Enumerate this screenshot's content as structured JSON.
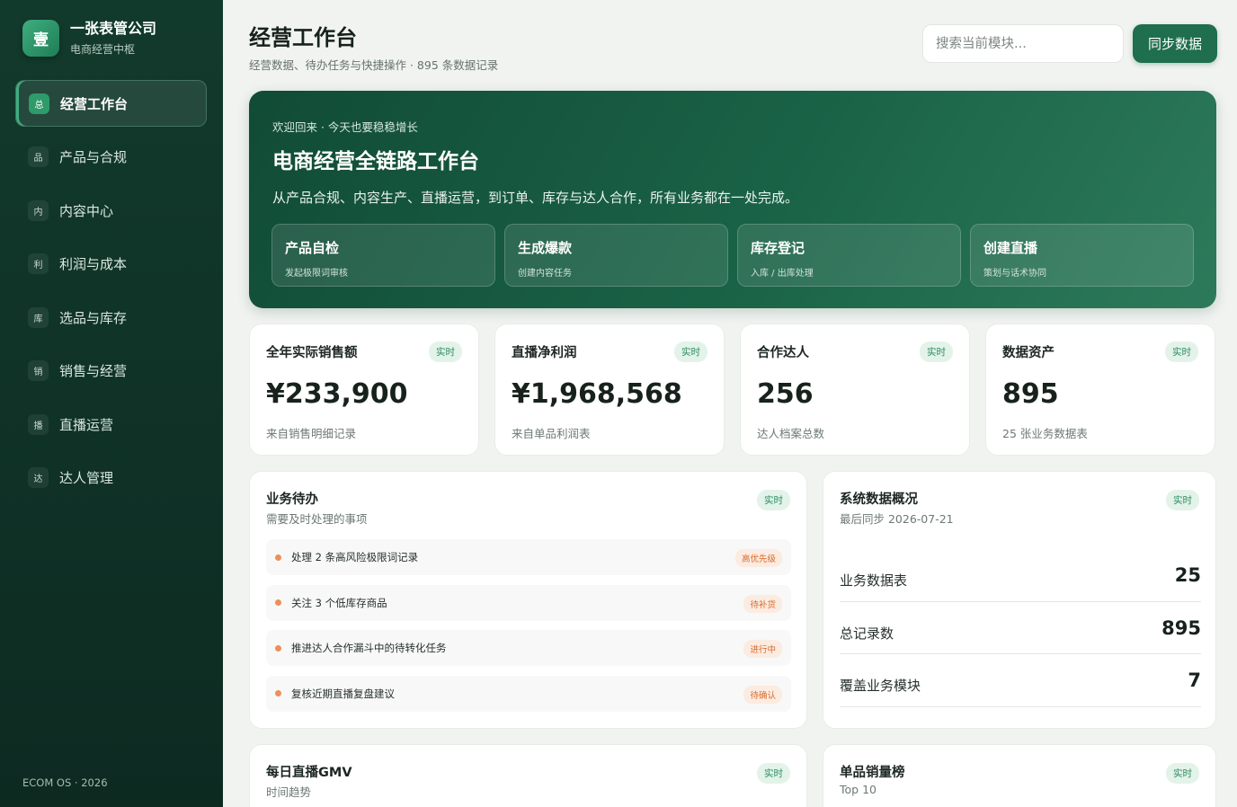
{
  "brand": {
    "logo": "壹",
    "name": "一张表管公司",
    "sub": "电商经营中枢"
  },
  "nav": [
    {
      "badge": "总",
      "label": "经营工作台"
    },
    {
      "badge": "品",
      "label": "产品与合规"
    },
    {
      "badge": "内",
      "label": "内容中心"
    },
    {
      "badge": "利",
      "label": "利润与成本"
    },
    {
      "badge": "库",
      "label": "选品与库存"
    },
    {
      "badge": "销",
      "label": "销售与经营"
    },
    {
      "badge": "播",
      "label": "直播运营"
    },
    {
      "badge": "达",
      "label": "达人管理"
    }
  ],
  "footer": "ECOM OS · 2026",
  "header": {
    "title": "经营工作台",
    "sub": "经营数据、待办任务与快捷操作 · 895 条数据记录",
    "search_placeholder": "搜索当前模块...",
    "sync_label": "同步数据"
  },
  "hero": {
    "kicker": "欢迎回来 · 今天也要稳稳增长",
    "title": "电商经营全链路工作台",
    "desc": "从产品合规、内容生产、直播运营，到订单、库存与达人合作，所有业务都在一处完成。",
    "actions": [
      {
        "title": "产品自检",
        "sub": "发起极限词审核"
      },
      {
        "title": "生成爆款",
        "sub": "创建内容任务"
      },
      {
        "title": "库存登记",
        "sub": "入库 / 出库处理"
      },
      {
        "title": "创建直播",
        "sub": "策划与话术协同"
      }
    ]
  },
  "stats": [
    {
      "label": "全年实际销售额",
      "tag": "实时",
      "value": "¥233,900",
      "note": "来自销售明细记录"
    },
    {
      "label": "直播净利润",
      "tag": "实时",
      "value": "¥1,968,568",
      "note": "来自单品利润表"
    },
    {
      "label": "合作达人",
      "tag": "实时",
      "value": "256",
      "note": "达人档案总数"
    },
    {
      "label": "数据资产",
      "tag": "实时",
      "value": "895",
      "note": "25 张业务数据表"
    }
  ],
  "todo": {
    "title": "业务待办",
    "sub": "需要及时处理的事项",
    "tag": "实时",
    "items": [
      {
        "text": "处理 2 条高风险极限词记录",
        "badge": "高优先级"
      },
      {
        "text": "关注 3 个低库存商品",
        "badge": "待补货"
      },
      {
        "text": "推进达人合作漏斗中的待转化任务",
        "badge": "进行中"
      },
      {
        "text": "复核近期直播复盘建议",
        "badge": "待确认"
      }
    ]
  },
  "system": {
    "title": "系统数据概况",
    "sub": "最后同步 2026-07-21",
    "tag": "实时",
    "rows": [
      {
        "label": "业务数据表",
        "value": "25"
      },
      {
        "label": "总记录数",
        "value": "895"
      },
      {
        "label": "覆盖业务模块",
        "value": "7"
      }
    ]
  },
  "gmv": {
    "title": "每日直播GMV",
    "sub": "时间趋势",
    "tag": "实时"
  },
  "ranking": {
    "title": "单品销量榜",
    "sub": "Top 10",
    "tag": "实时"
  },
  "colors": {
    "sidebar": "#123a2c",
    "accent": "#1f6e4d",
    "tag_bg": "#e3f3ea",
    "todo_dot": "#ef8e58"
  }
}
